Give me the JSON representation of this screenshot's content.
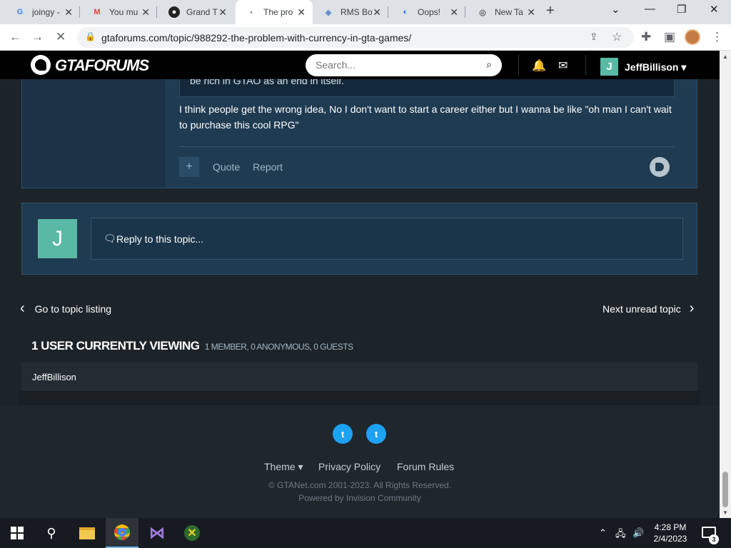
{
  "browser": {
    "tabs": [
      {
        "title": "joingy -",
        "icon": "google-icon"
      },
      {
        "title": "You mu",
        "icon": "gmail-icon"
      },
      {
        "title": "Grand T",
        "icon": "gtaforums-icon"
      },
      {
        "title": "The pro",
        "icon": "loading-icon"
      },
      {
        "title": "RMS Bo",
        "icon": "shield-icon"
      },
      {
        "title": "Oops!",
        "icon": "edge-icon"
      },
      {
        "title": "New Ta",
        "icon": "chrome-icon"
      }
    ],
    "url": "gtaforums.com/topic/988292-the-problem-with-currency-in-gta-games/"
  },
  "site": {
    "logo": "GTAFORUMS",
    "search_placeholder": "Search...",
    "user_initial": "J",
    "user_name": "JeffBillison"
  },
  "post": {
    "quote_fragment": "be rich in GTAO as an end in itself.",
    "body": "I think people get the wrong idea, No I don't want to start a career either but I wanna be like \"oh man I can't wait to purchase this cool RPG\"",
    "quote_label": "Quote",
    "report_label": "Report"
  },
  "reply": {
    "avatar_initial": "J",
    "placeholder": "Reply to this topic..."
  },
  "nav": {
    "prev": "Go to topic listing",
    "next": "Next unread topic"
  },
  "viewing": {
    "title": "1 USER CURRENTLY VIEWING",
    "detail": "1 MEMBER, 0 ANONYMOUS, 0 GUESTS",
    "users": [
      "JeffBillison"
    ]
  },
  "footer": {
    "theme": "Theme",
    "privacy": "Privacy Policy",
    "rules": "Forum Rules",
    "copyright": "© GTANet.com 2001-2023. All Rights Reserved.",
    "powered": "Powered by Invision Community"
  },
  "taskbar": {
    "time": "4:28 PM",
    "date": "2/4/2023",
    "notifications": "3"
  },
  "colors": {
    "post_bg": "#1f3b52",
    "accent_avatar": "#5ab9a4",
    "twitter": "#1da1f2"
  }
}
